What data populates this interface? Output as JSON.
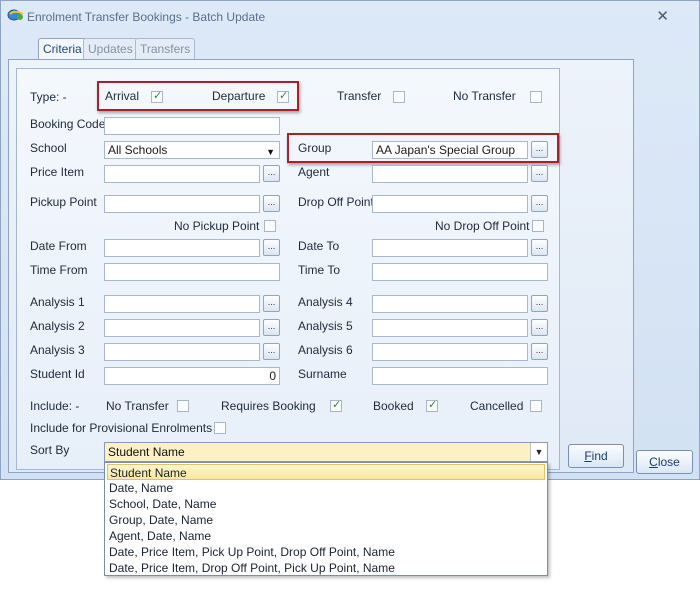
{
  "window": {
    "title": "Enrolment Transfer Bookings - Batch Update",
    "close_glyph": "✕"
  },
  "tabs": [
    {
      "label": "Criteria"
    },
    {
      "label": "Updates"
    },
    {
      "label": "Transfers"
    }
  ],
  "type_row": {
    "label": "Type: -",
    "arrival": {
      "label": "Arrival",
      "checked": true
    },
    "departure": {
      "label": "Departure",
      "checked": true
    },
    "transfer": {
      "label": "Transfer",
      "checked": false
    },
    "no_transfer": {
      "label": "No Transfer",
      "checked": false
    }
  },
  "fields": {
    "booking_code": {
      "label": "Booking Code",
      "value": ""
    },
    "school": {
      "label": "School",
      "value": "All Schools"
    },
    "group": {
      "label": "Group",
      "value": "AA Japan's Special Group"
    },
    "price_item": {
      "label": "Price Item",
      "value": ""
    },
    "agent": {
      "label": "Agent",
      "value": ""
    },
    "pickup_point": {
      "label": "Pickup Point",
      "value": ""
    },
    "drop_off_point": {
      "label": "Drop Off Point",
      "value": ""
    },
    "no_pickup_point": {
      "label": "No Pickup Point",
      "checked": false
    },
    "no_drop_off_point": {
      "label": "No Drop Off Point",
      "checked": false
    },
    "date_from": {
      "label": "Date From",
      "value": ""
    },
    "date_to": {
      "label": "Date To",
      "value": ""
    },
    "time_from": {
      "label": "Time From",
      "value": ""
    },
    "time_to": {
      "label": "Time To",
      "value": ""
    },
    "analysis_1": {
      "label": "Analysis 1",
      "value": ""
    },
    "analysis_2": {
      "label": "Analysis 2",
      "value": ""
    },
    "analysis_3": {
      "label": "Analysis 3",
      "value": ""
    },
    "analysis_4": {
      "label": "Analysis 4",
      "value": ""
    },
    "analysis_5": {
      "label": "Analysis 5",
      "value": ""
    },
    "analysis_6": {
      "label": "Analysis 6",
      "value": ""
    },
    "student_id": {
      "label": "Student Id",
      "value": "0"
    },
    "surname": {
      "label": "Surname",
      "value": ""
    }
  },
  "include_row": {
    "label": "Include: -",
    "no_transfer": {
      "label": "No Transfer",
      "checked": false
    },
    "requires_booking": {
      "label": "Requires Booking",
      "checked": true
    },
    "booked": {
      "label": "Booked",
      "checked": true
    },
    "cancelled": {
      "label": "Cancelled",
      "checked": false
    }
  },
  "provisional": {
    "label": "Include for Provisional Enrolments",
    "checked": false
  },
  "sort_by": {
    "label": "Sort By",
    "value": "Student Name",
    "options": [
      "Student Name",
      "Date,  Name",
      "School, Date,  Name",
      "Group, Date,  Name",
      "Agent, Date,  Name",
      "Date, Price Item, Pick Up Point, Drop Off Point,  Name",
      "Date, Price Item, Drop Off Point, Pick Up Point,  Name"
    ],
    "selected_index": 0
  },
  "buttons": {
    "find": {
      "first": "F",
      "rest": "ind"
    },
    "close": {
      "first": "C",
      "rest": "lose"
    }
  },
  "glyphs": {
    "ellipsis": "...",
    "dropdown_arrow": "▼",
    "check": "✓"
  },
  "colors": {
    "highlight_red": "#a8202a",
    "check_green": "#2f8a2f",
    "selected_row": "#fbf1c2"
  }
}
